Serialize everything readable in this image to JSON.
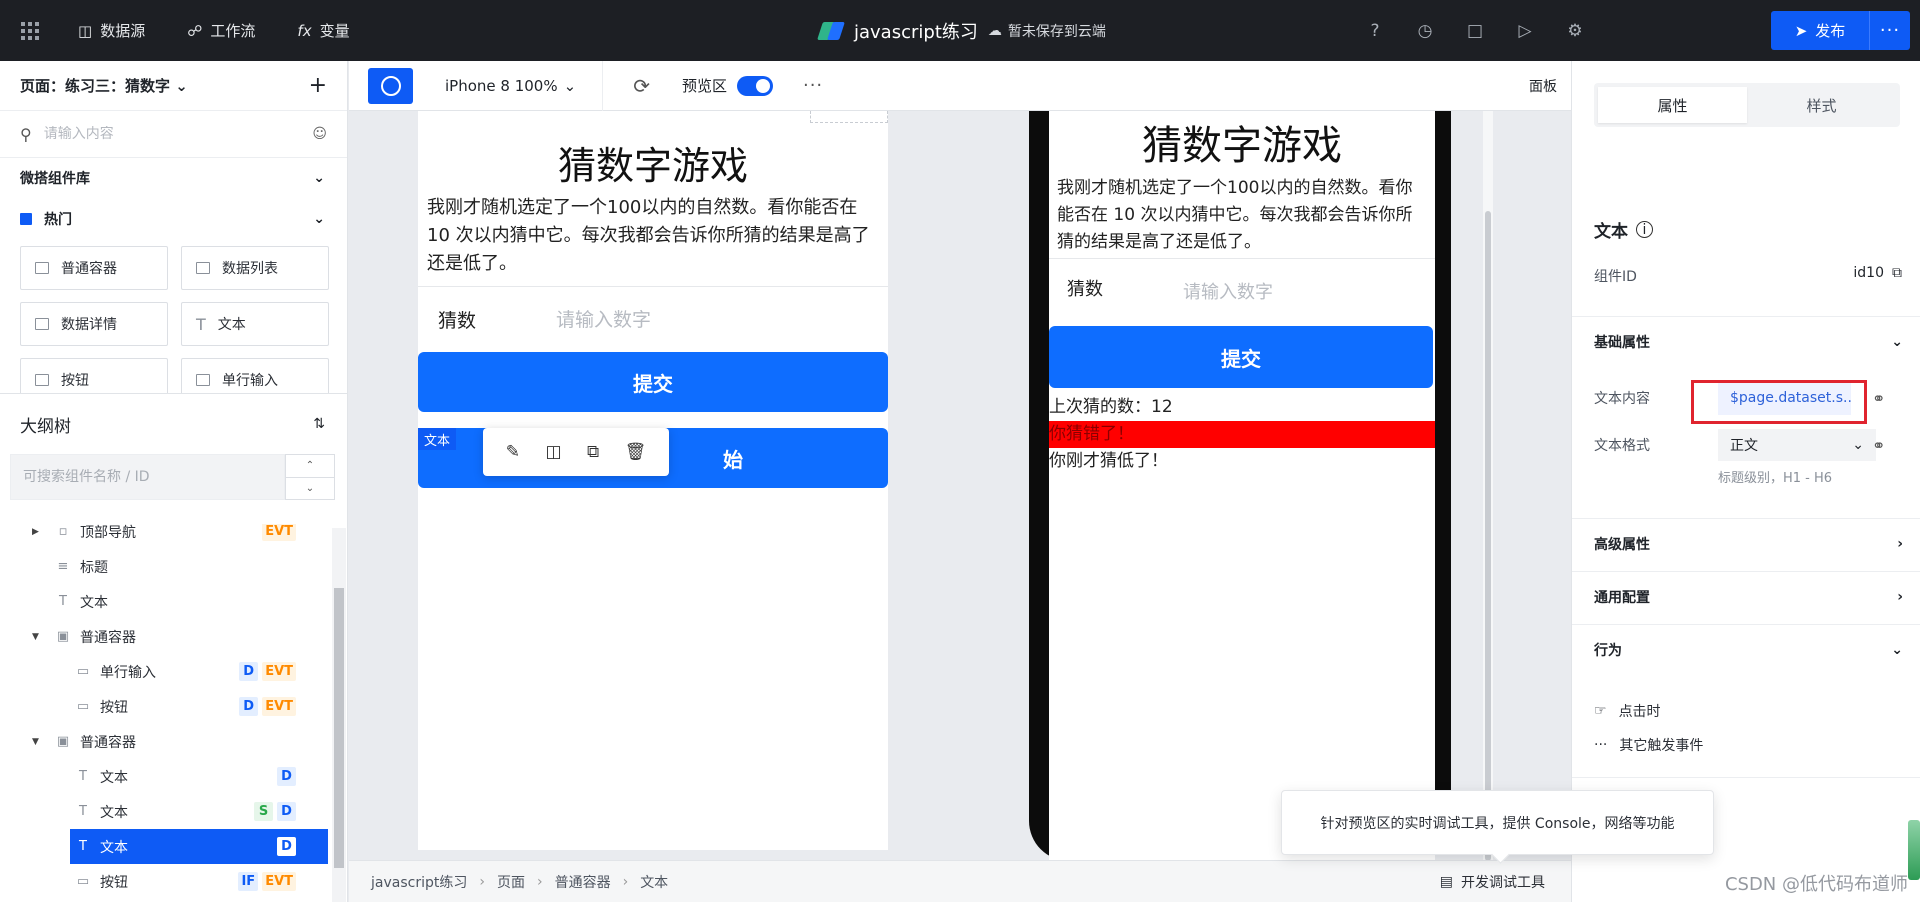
{
  "topbar": {
    "nav": [
      "数据源",
      "工作流",
      "变量"
    ],
    "app_title": "javascript练习",
    "save_status": "暂未保存到云端",
    "publish": "发布",
    "publish_more": "···"
  },
  "left": {
    "page_label": "页面：练习三：猜数字",
    "add_symbol": "+",
    "search_placeholder": "请输入内容",
    "library_title": "微搭组件库",
    "hot_title": "热门",
    "components": [
      "普通容器",
      "数据列表",
      "数据详情",
      "文本",
      "按钮",
      "单行输入"
    ],
    "outline_title": "大纲树",
    "outline_search_placeholder": "可搜索组件名称 / ID",
    "tree": [
      {
        "label": "顶部导航",
        "badges": [
          "EVT"
        ]
      },
      {
        "label": "标题",
        "badges": []
      },
      {
        "label": "文本",
        "badges": []
      },
      {
        "label": "普通容器",
        "badges": []
      },
      {
        "label": "单行输入",
        "badges": [
          "D",
          "EVT"
        ]
      },
      {
        "label": "按钮",
        "badges": [
          "D",
          "EVT"
        ]
      },
      {
        "label": "普通容器",
        "badges": []
      },
      {
        "label": "文本",
        "badges": [
          "D"
        ]
      },
      {
        "label": "文本",
        "badges": [
          "S",
          "D"
        ]
      },
      {
        "label": "文本",
        "badges": [
          "D"
        ]
      },
      {
        "label": "按钮",
        "badges": [
          "IF",
          "EVT"
        ]
      }
    ]
  },
  "toolbar": {
    "device": "iPhone 8 100%",
    "preview_label": "预览区",
    "preview_enabled": true,
    "more": "···",
    "panel": "面板"
  },
  "editor": {
    "title": "猜数字游戏",
    "intro": "我刚才随机选定了一个100以内的自然数。看你能否在 10 次以内猜中它。每次我都会告诉你所猜的结果是高了还是低了。",
    "guess_label": "猜数",
    "guess_placeholder": "请输入数字",
    "submit": "提交",
    "restart_visible": "始",
    "selection_tag": "文本"
  },
  "preview": {
    "title": "猜数字游戏",
    "intro": "我刚才随机选定了一个100以内的自然数。看你能否在 10 次以内猜中它。每次我都会告诉你所猜的结果是高了还是低了。",
    "guess_label": "猜数",
    "guess_placeholder": "请输入数字",
    "submit": "提交",
    "last_guess": "上次猜的数：12",
    "wrong": "你猜错了！",
    "low": "你刚才猜低了！"
  },
  "tooltip": "针对预览区的实时调试工具，提供 Console，网络等功能",
  "bottom": {
    "breadcrumb": [
      "javascript练习",
      "页面",
      "普通容器",
      "文本"
    ],
    "devtools": "开发调试工具"
  },
  "right": {
    "tabs": [
      "属性",
      "样式"
    ],
    "component_title": "文本",
    "id_label": "组件ID",
    "id_value": "id10",
    "basic_section": "基础属性",
    "text_content_label": "文本内容",
    "text_content_value": "$page.dataset.s...",
    "text_format_label": "文本格式",
    "text_format_value": "正文",
    "text_format_hint": "标题级别，H1 - H6",
    "advanced_section": "高级属性",
    "common_section": "通用配置",
    "behavior_section": "行为",
    "events": [
      "点击时",
      "其它触发事件"
    ]
  },
  "watermark": "CSDN @低代码布道师",
  "colors": {
    "brand": "#0e5bf5",
    "dark_bar": "#1d1f24",
    "error": "#ff0000"
  }
}
